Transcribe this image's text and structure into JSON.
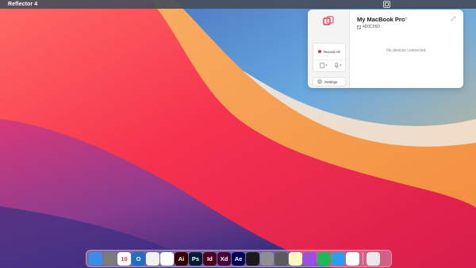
{
  "menubar": {
    "app_name": "Reflector 4",
    "status_icon": "reflector-menubar-icon"
  },
  "panel": {
    "device_name": "My MacBook Pro",
    "device_code": "4D0C05D",
    "record_label": "Record All",
    "settings_label": "Settings",
    "empty_message": "No devices connected."
  },
  "dock": {
    "apps": [
      {
        "name": "finder-icon",
        "glyph": "",
        "bg": "#3b8ee6"
      },
      {
        "name": "app-icon",
        "glyph": "",
        "bg": "#7b7b7b"
      },
      {
        "name": "calendar-icon",
        "glyph": "10",
        "bg": "#ffffff"
      },
      {
        "name": "outlook-icon",
        "glyph": "O",
        "bg": "#1f6fc2"
      },
      {
        "name": "chrome-icon",
        "glyph": "",
        "bg": "#f2f2f2"
      },
      {
        "name": "slack-icon",
        "glyph": "",
        "bg": "#ffffff"
      },
      {
        "name": "illustrator-icon",
        "glyph": "Ai",
        "bg": "#330000"
      },
      {
        "name": "photoshop-icon",
        "glyph": "Ps",
        "bg": "#001d34"
      },
      {
        "name": "indesign-icon",
        "glyph": "Id",
        "bg": "#49021f"
      },
      {
        "name": "xd-icon",
        "glyph": "Xd",
        "bg": "#470137"
      },
      {
        "name": "after-effects-icon",
        "glyph": "Ae",
        "bg": "#00005b"
      },
      {
        "name": "acrobat-icon",
        "glyph": "",
        "bg": "#1a1a1a"
      },
      {
        "name": "system-preferences-icon",
        "glyph": "",
        "bg": "#8e8e93"
      },
      {
        "name": "preview-icon",
        "glyph": "",
        "bg": "#5a5a5a"
      },
      {
        "name": "notes-icon",
        "glyph": "",
        "bg": "#fff6c2"
      },
      {
        "name": "podcasts-icon",
        "glyph": "",
        "bg": "#9b4ee0"
      },
      {
        "name": "spotify-icon",
        "glyph": "",
        "bg": "#1db954"
      },
      {
        "name": "no-entry-icon",
        "glyph": "",
        "bg": "#2f9bf0"
      },
      {
        "name": "reflector-icon",
        "glyph": "",
        "bg": "#ffffff"
      }
    ],
    "trash": {
      "name": "trash-icon",
      "glyph": "",
      "bg": "#e9e9ec"
    }
  },
  "colors": {
    "accent": "#e5334a",
    "wallpaper_orange": "#f5a04a",
    "wallpaper_red": "#f4364c",
    "wallpaper_blue": "#3b5fa8"
  }
}
